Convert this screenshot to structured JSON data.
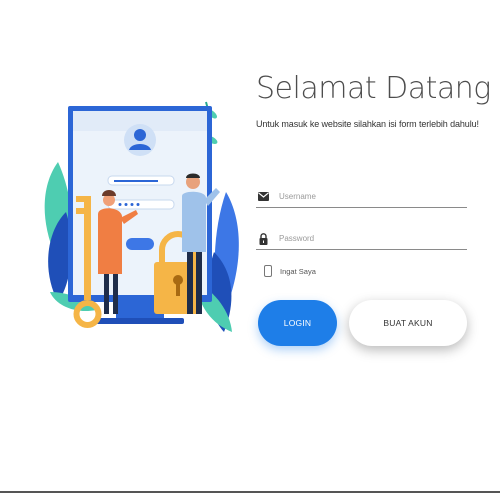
{
  "illustration": {
    "icon": "login-illustration",
    "colors": {
      "monitor_frame": "#2c66d6",
      "screen": "#ecf3fb",
      "leaf_teal": "#4ecdb1",
      "leaf_blue": "#3d77e6",
      "key_and_lock": "#f5b547",
      "person_shirt": "#f07e43",
      "person_coat": "#9fc2ea"
    }
  },
  "form": {
    "title": "Selamat Datang :)",
    "subtitle": "Untuk masuk ke website silahkan isi form terlebih dahulu!",
    "username": {
      "icon": "envelope-icon",
      "placeholder": "Username",
      "value": ""
    },
    "password": {
      "icon": "lock-icon",
      "placeholder": "Password",
      "value": ""
    },
    "remember": {
      "label": "Ingat Saya",
      "checked": false
    },
    "login_button": "LOGIN",
    "register_button": "BUAT AKUN"
  },
  "colors": {
    "primary": "#1e7ee8",
    "title_text": "#4d4d4d",
    "background": "#ffffff"
  }
}
